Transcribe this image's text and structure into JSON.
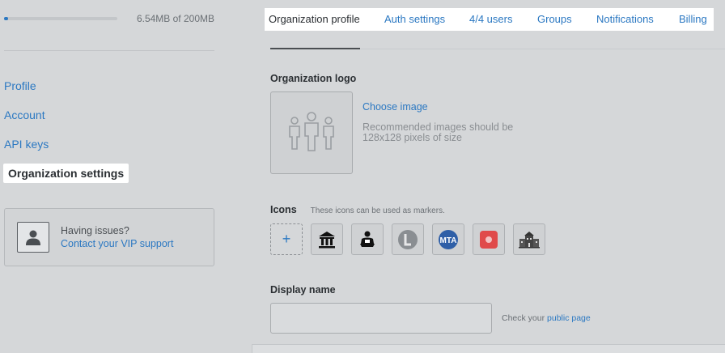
{
  "storage": {
    "text": "6.54MB of 200MB",
    "used_fraction": 0.0327,
    "accent": "#2b78c2"
  },
  "sidebar": {
    "items": [
      {
        "label": "Profile"
      },
      {
        "label": "Account"
      },
      {
        "label": "API keys"
      },
      {
        "label": "Organization settings"
      }
    ]
  },
  "support": {
    "question": "Having issues?",
    "link": "Contact your VIP support",
    "icon": "person-icon"
  },
  "tabs": [
    {
      "label": "Organization profile"
    },
    {
      "label": "Auth settings"
    },
    {
      "label": "4/4 users"
    },
    {
      "label": "Groups"
    },
    {
      "label": "Notifications"
    },
    {
      "label": "Billing"
    }
  ],
  "logo": {
    "label": "Organization logo",
    "choose": "Choose image",
    "hint": "Recommended images should be 128x128 pixels of size",
    "placeholder_icon": "group-people-icon"
  },
  "icons": {
    "label": "Icons",
    "note": "These icons can be used as markers.",
    "add_symbol": "+",
    "markers": [
      "bank-icon",
      "reading-person-icon",
      "letter-l-icon",
      "mta-icon",
      "red-dot-icon",
      "school-building-icon"
    ]
  },
  "display_name": {
    "label": "Display name",
    "value": "",
    "placeholder": "",
    "hint_prefix": "Check your",
    "hint_link": "public page"
  }
}
